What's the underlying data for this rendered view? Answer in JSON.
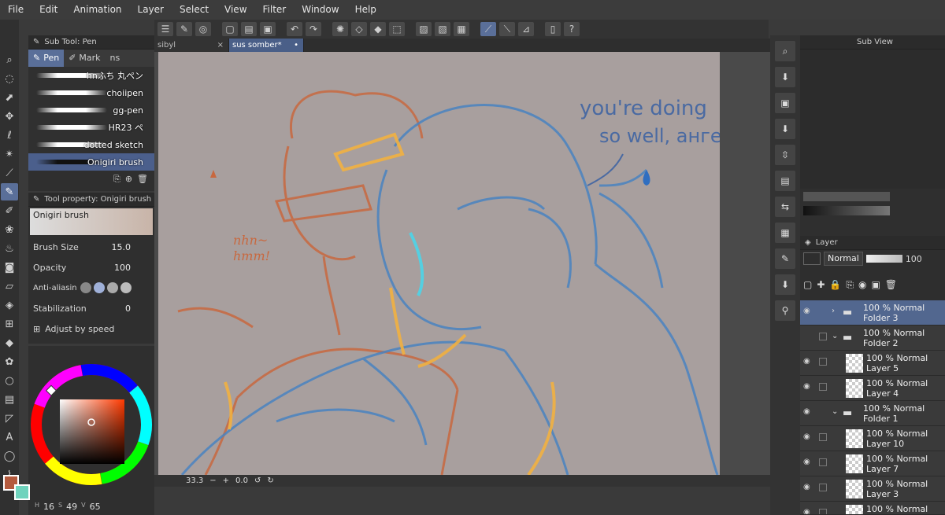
{
  "menu": [
    "File",
    "Edit",
    "Animation",
    "Layer",
    "Select",
    "View",
    "Filter",
    "Window",
    "Help"
  ],
  "subtool": {
    "header": "Sub Tool: Pen",
    "tabs": [
      {
        "label": "Pen"
      },
      {
        "label": "Mark"
      },
      {
        "label": "ns"
      }
    ],
    "brushes": [
      "hnふち 丸ペン",
      "choiipen",
      "gg-pen",
      "HR23 ペ",
      "dotted sketch",
      "Onigiri brush"
    ]
  },
  "toolprop": {
    "header": "Tool property: Onigiri brush",
    "brush_name": "Onigiri brush",
    "brush_size_label": "Brush Size",
    "brush_size_value": "15.0",
    "opacity_label": "Opacity",
    "opacity_value": "100",
    "antialias_label": "Anti-aliasin",
    "stabilization_label": "Stabilization",
    "stabilization_value": "0",
    "adjust_label": "Adjust by speed"
  },
  "color": {
    "h_label": "H",
    "h_value": "16",
    "s_label": "S",
    "s_value": "49",
    "v_label": "V",
    "v_value": "65",
    "main": "#b45a3d",
    "sub": "#6fd3bd"
  },
  "docs": [
    {
      "name": "sibyl"
    },
    {
      "name": "sus somber*"
    }
  ],
  "status": {
    "zoom": "33.3",
    "rotation": "0.0"
  },
  "artwork_text": {
    "line1": "you're doing",
    "line2": "so well, ангел",
    "hum1": "nhn~",
    "hum2": "hmm!"
  },
  "subview": {
    "header": "Sub View"
  },
  "layers": {
    "header": "Layer",
    "blend_mode": "Normal",
    "opacity": "100",
    "rows": [
      {
        "pct": "100 % Normal",
        "name": "Folder 3",
        "type": "folder"
      },
      {
        "pct": "100 % Normal",
        "name": "Folder 2",
        "type": "folder"
      },
      {
        "pct": "100 % Normal",
        "name": "Layer 5",
        "type": "layer"
      },
      {
        "pct": "100 % Normal",
        "name": "Layer 4",
        "type": "layer"
      },
      {
        "pct": "100 % Normal",
        "name": "Folder 1",
        "type": "folder"
      },
      {
        "pct": "100 % Normal",
        "name": "Layer 10",
        "type": "layer"
      },
      {
        "pct": "100 % Normal",
        "name": "Layer 7",
        "type": "layer"
      },
      {
        "pct": "100 % Normal",
        "name": "Layer 3",
        "type": "layer"
      },
      {
        "pct": "100 % Normal",
        "name": "",
        "type": "layer"
      }
    ]
  }
}
